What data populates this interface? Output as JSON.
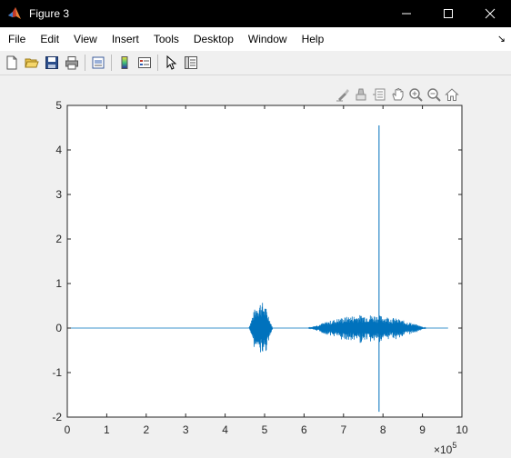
{
  "window": {
    "title": "Figure 3",
    "icon": "matlab-icon"
  },
  "menu": {
    "items": [
      "File",
      "Edit",
      "View",
      "Insert",
      "Tools",
      "Desktop",
      "Window",
      "Help"
    ]
  },
  "toolbar": {
    "buttons": [
      "new-figure-icon",
      "open-file-icon",
      "save-icon",
      "print-icon",
      "print-preview-icon",
      "colorbar-icon",
      "legend-icon",
      "pointer-icon",
      "property-editor-icon"
    ]
  },
  "axes_toolbar": {
    "buttons": [
      "brush-icon",
      "data-tips-icon",
      "pan-icon",
      "zoom-in-icon",
      "zoom-out-icon",
      "home-icon"
    ]
  },
  "chart_data": {
    "type": "line",
    "title": "",
    "xlabel": "",
    "ylabel": "",
    "xlim": [
      0,
      1000000
    ],
    "ylim": [
      -2,
      5
    ],
    "x_exponent_label": "×10",
    "x_exponent_power": "5",
    "xticks": [
      0,
      1,
      2,
      3,
      4,
      5,
      6,
      7,
      8,
      9,
      10
    ],
    "xtick_labels": [
      "0",
      "1",
      "2",
      "3",
      "4",
      "5",
      "6",
      "7",
      "8",
      "9",
      "10"
    ],
    "yticks": [
      -2,
      -1,
      0,
      1,
      2,
      3,
      4,
      5
    ],
    "ytick_labels": [
      "-2",
      "-1",
      "0",
      "1",
      "2",
      "3",
      "4",
      "5"
    ],
    "grid": false,
    "line_color": "#0072bd",
    "series": [
      {
        "segments": [
          {
            "x_start": 0,
            "x_end": 460000,
            "amplitude": 0.01
          },
          {
            "x_start": 460000,
            "x_end": 520000,
            "amplitude_max": 0.6,
            "amplitude_min": -0.6
          },
          {
            "x_start": 520000,
            "x_end": 610000,
            "amplitude": 0.02
          },
          {
            "x_start": 610000,
            "x_end": 910000,
            "amplitude_max": 0.3,
            "amplitude_min": -0.3
          },
          {
            "x_start": 910000,
            "x_end": 965000,
            "amplitude": 0.01
          }
        ],
        "spike": {
          "x": 790000,
          "y_max": 4.55,
          "y_min": -1.88
        }
      }
    ]
  }
}
